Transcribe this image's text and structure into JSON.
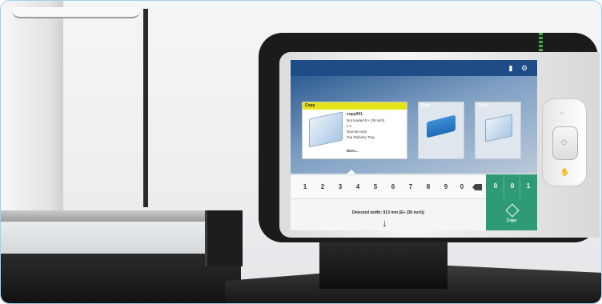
{
  "screen": {
    "tiles": {
      "copy": {
        "header": "Copy",
        "job_name": "copy001",
        "lines": [
          "Not loaded E+ (36 inch)",
          "1:1",
          "Normal color",
          "Top Delivery Tray"
        ],
        "more": "More..."
      },
      "scan": {
        "header": "Scan"
      },
      "print": {
        "header": "Print"
      }
    },
    "keypad": [
      "1",
      "2",
      "3",
      "4",
      "5",
      "6",
      "7",
      "8",
      "9",
      "0"
    ],
    "counter": [
      "0",
      "0",
      "1"
    ],
    "status_text": "Detected width: 913 mm (E+ (36 inch))",
    "copy_button_label": "Copy"
  },
  "colors": {
    "topbar": "#1f4c87",
    "accent_green": "#2e9b74",
    "copy_header_yellow": "#e6e21a"
  },
  "icons": {
    "topbar": [
      "windows-icon",
      "settings-icon"
    ],
    "copy_action": "diamond-start-icon",
    "scroll": "arrow-down-icon",
    "backspace": "backspace-icon"
  }
}
